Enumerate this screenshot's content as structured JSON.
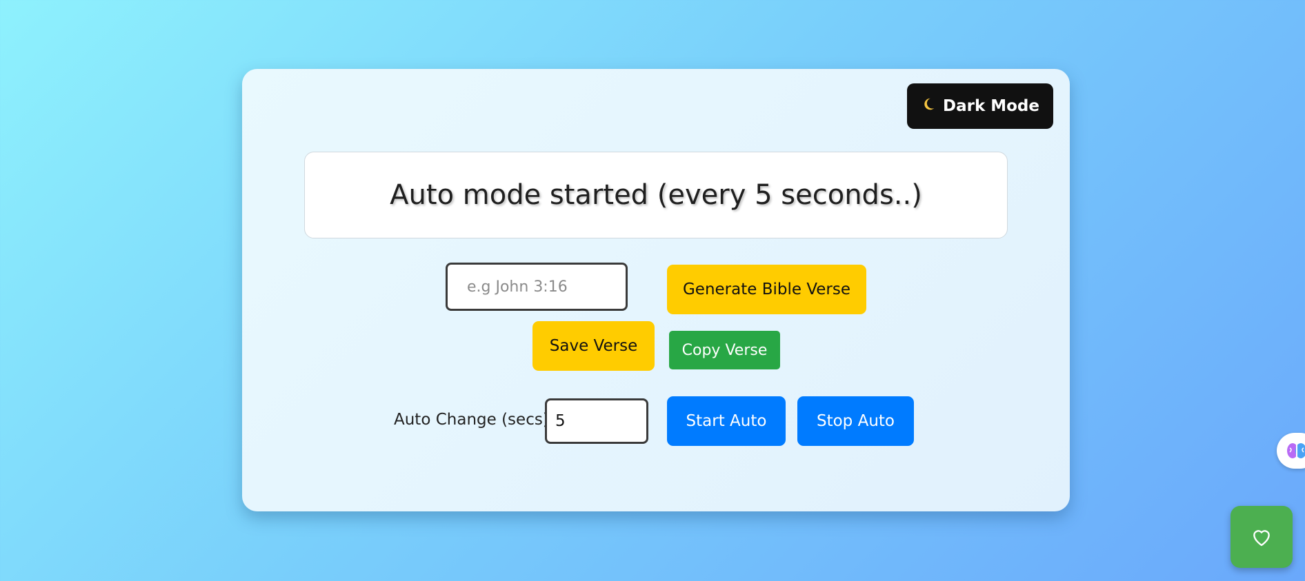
{
  "dark_mode_button": {
    "icon": "moon-icon",
    "label": "Dark Mode"
  },
  "verse_display": {
    "text": "Auto mode started (every 5 seconds..)"
  },
  "reference_input": {
    "placeholder": "e.g John 3:16",
    "value": ""
  },
  "buttons": {
    "generate": "Generate Bible Verse",
    "save": "Save Verse",
    "copy": "Copy Verse",
    "start_auto": "Start Auto",
    "stop_auto": "Stop Auto"
  },
  "auto_change": {
    "label": "Auto Change (secs):",
    "value": "5"
  },
  "floating_widgets": {
    "brain": "brain-icon",
    "heart": "heart-icon"
  },
  "colors": {
    "accent_yellow": "#ffcc00",
    "copy_green": "#28a745",
    "auto_blue": "#007bff",
    "dark_button": "#111111",
    "heart_green": "#4caf50"
  }
}
